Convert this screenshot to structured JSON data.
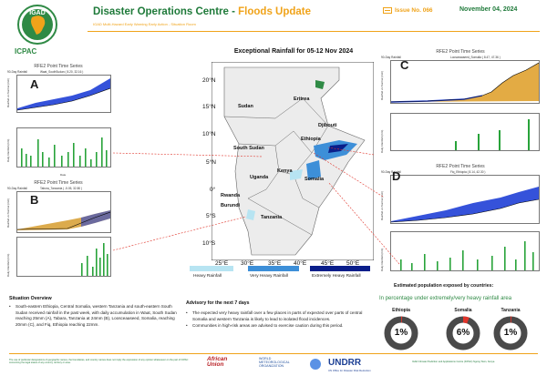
{
  "header": {
    "logo_name": "IGAD",
    "logo_text": "ICPAC",
    "title_main": "Disaster Operations Centre",
    "title_sep": " - ",
    "title_accent": "Floods Update",
    "subtitle": "IGAD Multi-Hazard Early Warning Early Action - Situation Room",
    "issue": "Issue No. 066",
    "date": "November 04, 2024"
  },
  "map": {
    "title": "Exceptional Rainfall for 05-12 Nov 2024",
    "lat_labels": [
      "20°N",
      "15°N",
      "10°N",
      "5°N",
      "0°",
      "5°S",
      "10°S"
    ],
    "lon_labels": [
      "25°E",
      "30°E",
      "35°E",
      "40°E",
      "45°E",
      "50°E"
    ],
    "countries": [
      "Sudan",
      "Eritrea",
      "Djibouti",
      "Ethiopia",
      "South Sudan",
      "Kenya",
      "Uganda",
      "Somalia",
      "Rwanda",
      "Burundi",
      "Tanzania"
    ],
    "legend": [
      {
        "label": "Heavy Rainfall",
        "color": "#b7e4f2"
      },
      {
        "label": "Very Heavy Rainfall",
        "color": "#3d8fd8"
      },
      {
        "label": "Extremely Heavy Rainfall",
        "color": "#0a1e8a"
      }
    ]
  },
  "panels": {
    "A": {
      "letter": "A",
      "title": "RFE2 Point Time Series",
      "sub_left": "90-Day Rainfall",
      "sub_mid": "Waat_SouthSudan ( 8.20, 32.16 )",
      "y1": "Rainfall vs Normal (mm)",
      "y2": "Daily Rainfall (mm)",
      "x": "Date"
    },
    "B": {
      "letter": "B",
      "title": "RFE2 Point Time Series",
      "sub_left": "90-Day Rainfall",
      "sub_mid": "Tabora_Tanzania ( -5.05, 32.80 )",
      "y1": "Rainfall vs Normal (mm)",
      "y2": "Daily Rainfall (mm)",
      "x": "Date"
    },
    "C": {
      "letter": "C",
      "title": "RFE2 Point Time Series",
      "sub_left": "90-Day Rainfall",
      "sub_mid": "Loosceaaseed_Somalia ( 8.47, 47.36 )",
      "y1": "Rainfall vs Normal (mm)",
      "y2": "Daily Rainfall (mm)",
      "x": "Date"
    },
    "D": {
      "letter": "D",
      "title": "RFE2 Point Time Series",
      "sub_left": "90-Day Rainfall",
      "sub_mid": "Fiq_Ethiopia ( 8.14, 42.30 )",
      "y1": "Rainfall vs Normal (mm)",
      "y2": "Daily Rainfall (mm)",
      "x": "Date"
    }
  },
  "situation": {
    "title": "Situation Overview",
    "bullets": [
      "South-eastern Ethiopia, Central Somalia, western Tanzania and south-eastern South Sudan received rainfall in the past week, with daily accumulation in Waat, South Sudan reaching 25mm (A), Tabara, Tanzania at 24mm (B), Loosceaaseed, Somalia, reaching 20mm (C), and Fiq, Ethiopia reaching 22mm."
    ]
  },
  "advisory": {
    "title": "Advisory for the next 7 days",
    "bullets": [
      "The expected very heavy rainfall over a few places in parts of expected over parts of central Somalia and western Tanzania is likely to lead to isolated flood incidences.",
      "Communities in high-risk areas are advised to exercise caution during this period."
    ]
  },
  "population": {
    "title": "Estimated population exposed by countries:",
    "subtitle": "In percentage under extremely/very heavy rainfall area",
    "items": [
      {
        "country": "Ethiopia",
        "value": "1%",
        "pct": 1
      },
      {
        "country": "Somalia",
        "value": "6%",
        "pct": 6
      },
      {
        "country": "Tanzania",
        "value": "1%",
        "pct": 1
      }
    ]
  },
  "footer": {
    "left": "The use of particular designations of geographic names, the boundaries, and country names does not imply the expression of any opinion whatsoever on the part of ICPAC concerning the legal status of any country, territory or area.",
    "au": "African\nUnion",
    "wmo": "WORLD\nMETEOROLOGICAL\nORGANIZATION",
    "undrr": "UNDRR",
    "undrr_sub": "UN Office for Disaster Risk Reduction",
    "right": "IGAD Climate Prediction and Applications Centre (ICPAC) Ngong Town, Kenya"
  }
}
